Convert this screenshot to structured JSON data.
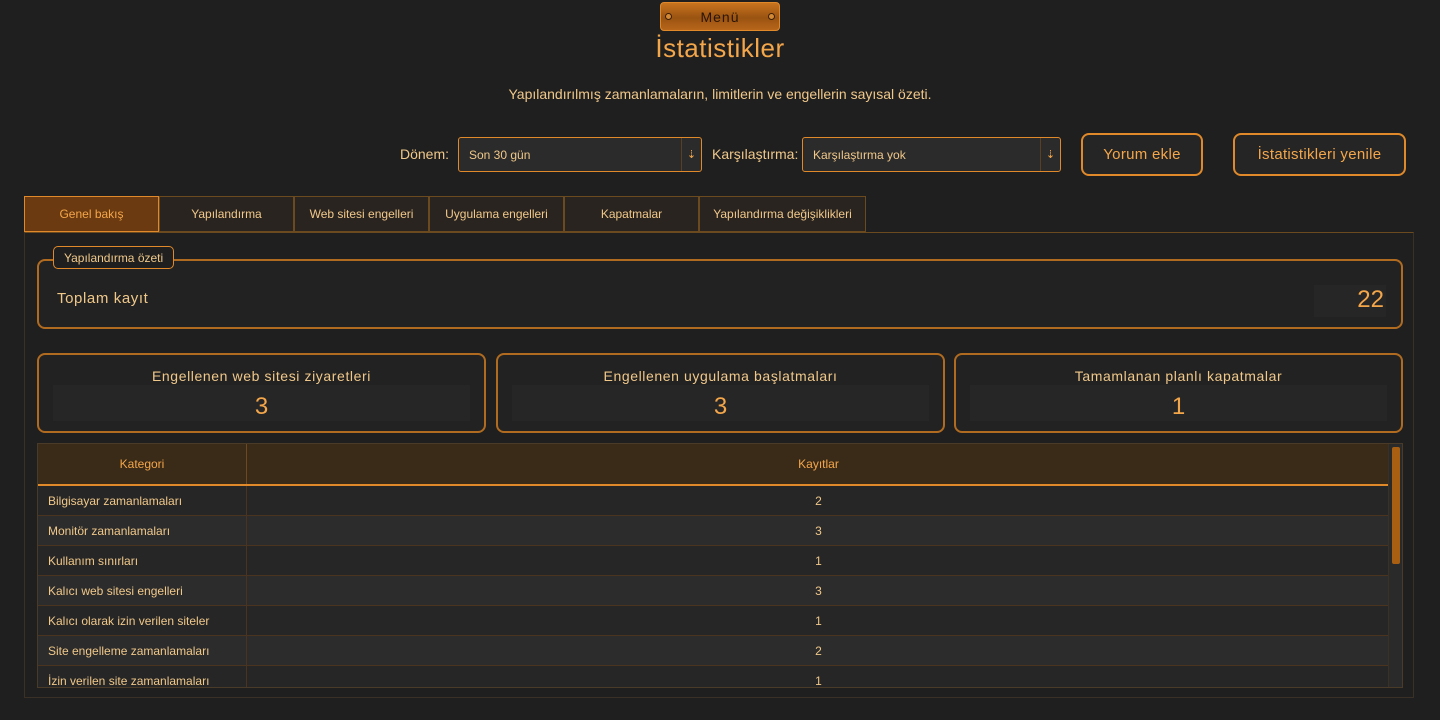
{
  "menu": {
    "label": "Menü"
  },
  "page": {
    "title": "İstatistikler",
    "subtitle": "Yapılandırılmış zamanlamaların, limitlerin ve engellerin sayısal özeti."
  },
  "filters": {
    "period_label": "Dönem:",
    "period_value": "Son 30 gün",
    "compare_label": "Karşılaştırma:",
    "compare_value": "Karşılaştırma yok"
  },
  "actions": {
    "comment_label": "Yorum ekle",
    "refresh_label": "İstatistikleri yenile"
  },
  "tabs": [
    {
      "label": "Genel bakış",
      "active": true
    },
    {
      "label": "Yapılandırma"
    },
    {
      "label": "Web sitesi engelleri"
    },
    {
      "label": "Uygulama engelleri"
    },
    {
      "label": "Kapatmalar"
    },
    {
      "label": "Yapılandırma değişiklikleri"
    }
  ],
  "summary": {
    "legend": "Yapılandırma özeti",
    "label": "Toplam kayıt",
    "value": "22"
  },
  "cards": [
    {
      "label": "Engellenen web sitesi ziyaretleri",
      "value": "3"
    },
    {
      "label": "Engellenen uygulama başlatmaları",
      "value": "3"
    },
    {
      "label": "Tamamlanan planlı kapatmalar",
      "value": "1"
    }
  ],
  "table": {
    "headers": [
      "Kategori",
      "Kayıtlar"
    ],
    "rows": [
      [
        "Bilgisayar zamanlamaları",
        "2"
      ],
      [
        "Monitör zamanlamaları",
        "3"
      ],
      [
        "Kullanım sınırları",
        "1"
      ],
      [
        "Kalıcı web sitesi engelleri",
        "3"
      ],
      [
        "Kalıcı olarak izin verilen siteler",
        "1"
      ],
      [
        "Site engelleme zamanlamaları",
        "2"
      ],
      [
        "İzin verilen site zamanlamaları",
        "1"
      ]
    ]
  },
  "colors": {
    "accent": "#e0892a",
    "accent_text": "#f4a64a",
    "text": "#f0c88a",
    "background": "#1f1f1f"
  }
}
